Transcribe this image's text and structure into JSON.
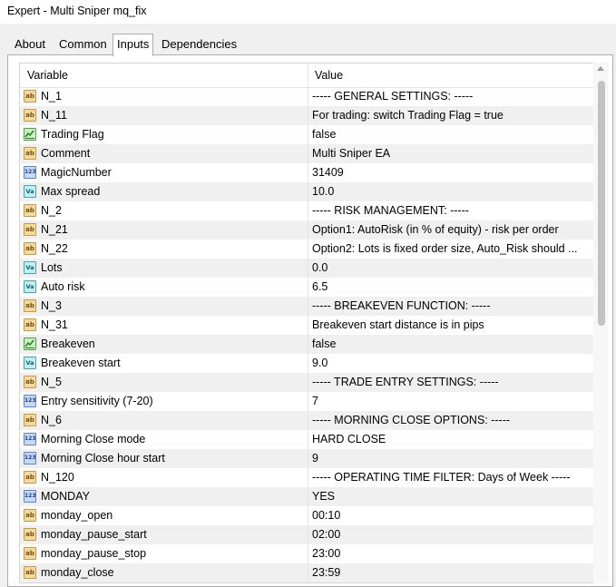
{
  "window": {
    "title": "Expert - Multi Sniper mq_fix"
  },
  "tabs": [
    {
      "label": "About",
      "active": false
    },
    {
      "label": "Common",
      "active": false
    },
    {
      "label": "Inputs",
      "active": true
    },
    {
      "label": "Dependencies",
      "active": false
    }
  ],
  "grid": {
    "headers": {
      "variable": "Variable",
      "value": "Value"
    },
    "rows": [
      {
        "type": "string",
        "icon": "string-type-icon",
        "name": "N_1",
        "value": "----- GENERAL SETTINGS: -----"
      },
      {
        "type": "string",
        "icon": "string-type-icon",
        "name": "N_11",
        "value": "For trading: switch Trading Flag = true"
      },
      {
        "type": "bool",
        "icon": "boolean-type-icon",
        "name": "Trading Flag",
        "value": "false"
      },
      {
        "type": "string",
        "icon": "string-type-icon",
        "name": "Comment",
        "value": " Multi Sniper EA"
      },
      {
        "type": "int",
        "icon": "integer-type-icon",
        "name": "MagicNumber",
        "value": "31409"
      },
      {
        "type": "double",
        "icon": "double-type-icon",
        "name": "Max spread",
        "value": "10.0"
      },
      {
        "type": "string",
        "icon": "string-type-icon",
        "name": "N_2",
        "value": "----- RISK MANAGEMENT: -----"
      },
      {
        "type": "string",
        "icon": "string-type-icon",
        "name": "N_21",
        "value": "Option1: AutoRisk (in % of equity) - risk per order"
      },
      {
        "type": "string",
        "icon": "string-type-icon",
        "name": "N_22",
        "value": "Option2: Lots is fixed order size, Auto_Risk should ..."
      },
      {
        "type": "double",
        "icon": "double-type-icon",
        "name": "Lots",
        "value": "0.0"
      },
      {
        "type": "double",
        "icon": "double-type-icon",
        "name": "Auto risk",
        "value": "6.5"
      },
      {
        "type": "string",
        "icon": "string-type-icon",
        "name": "N_3",
        "value": "-----  BREAKEVEN FUNCTION: -----"
      },
      {
        "type": "string",
        "icon": "string-type-icon",
        "name": "N_31",
        "value": "Breakeven start distance is in pips"
      },
      {
        "type": "bool",
        "icon": "boolean-type-icon",
        "name": "Breakeven",
        "value": "false"
      },
      {
        "type": "double",
        "icon": "double-type-icon",
        "name": "Breakeven start",
        "value": "9.0"
      },
      {
        "type": "string",
        "icon": "string-type-icon",
        "name": "N_5",
        "value": "----- TRADE ENTRY SETTINGS: -----"
      },
      {
        "type": "int",
        "icon": "integer-type-icon",
        "name": "Entry sensitivity (7-20)",
        "value": "7"
      },
      {
        "type": "string",
        "icon": "string-type-icon",
        "name": "N_6",
        "value": "----- MORNING CLOSE OPTIONS: -----"
      },
      {
        "type": "int",
        "icon": "integer-type-icon",
        "name": "Morning Close mode",
        "value": "HARD CLOSE"
      },
      {
        "type": "int",
        "icon": "integer-type-icon",
        "name": "Morning Close hour start",
        "value": "9"
      },
      {
        "type": "string",
        "icon": "string-type-icon",
        "name": "N_120",
        "value": "----- OPERATING TIME FILTER: Days of Week -----"
      },
      {
        "type": "int",
        "icon": "integer-type-icon",
        "name": "MONDAY",
        "value": "YES"
      },
      {
        "type": "string",
        "icon": "string-type-icon",
        "name": "monday_open",
        "value": "00:10"
      },
      {
        "type": "string",
        "icon": "string-type-icon",
        "name": "monday_pause_start",
        "value": "02:00"
      },
      {
        "type": "string",
        "icon": "string-type-icon",
        "name": "monday_pause_stop",
        "value": "23:00"
      },
      {
        "type": "string",
        "icon": "string-type-icon",
        "name": "monday_close",
        "value": "23:59"
      },
      {
        "type": "int",
        "icon": "integer-type-icon",
        "name": "",
        "value": ""
      }
    ]
  },
  "icon_glyphs": {
    "string": "ab",
    "int": "123",
    "double": "Va"
  },
  "colors": {
    "row_alt_background": "#f0f0f0",
    "string_icon": "#f3d9a4",
    "integer_icon": "#c7d9f7",
    "double_icon": "#c7ecf0",
    "boolean_icon": "#c9efc4"
  }
}
